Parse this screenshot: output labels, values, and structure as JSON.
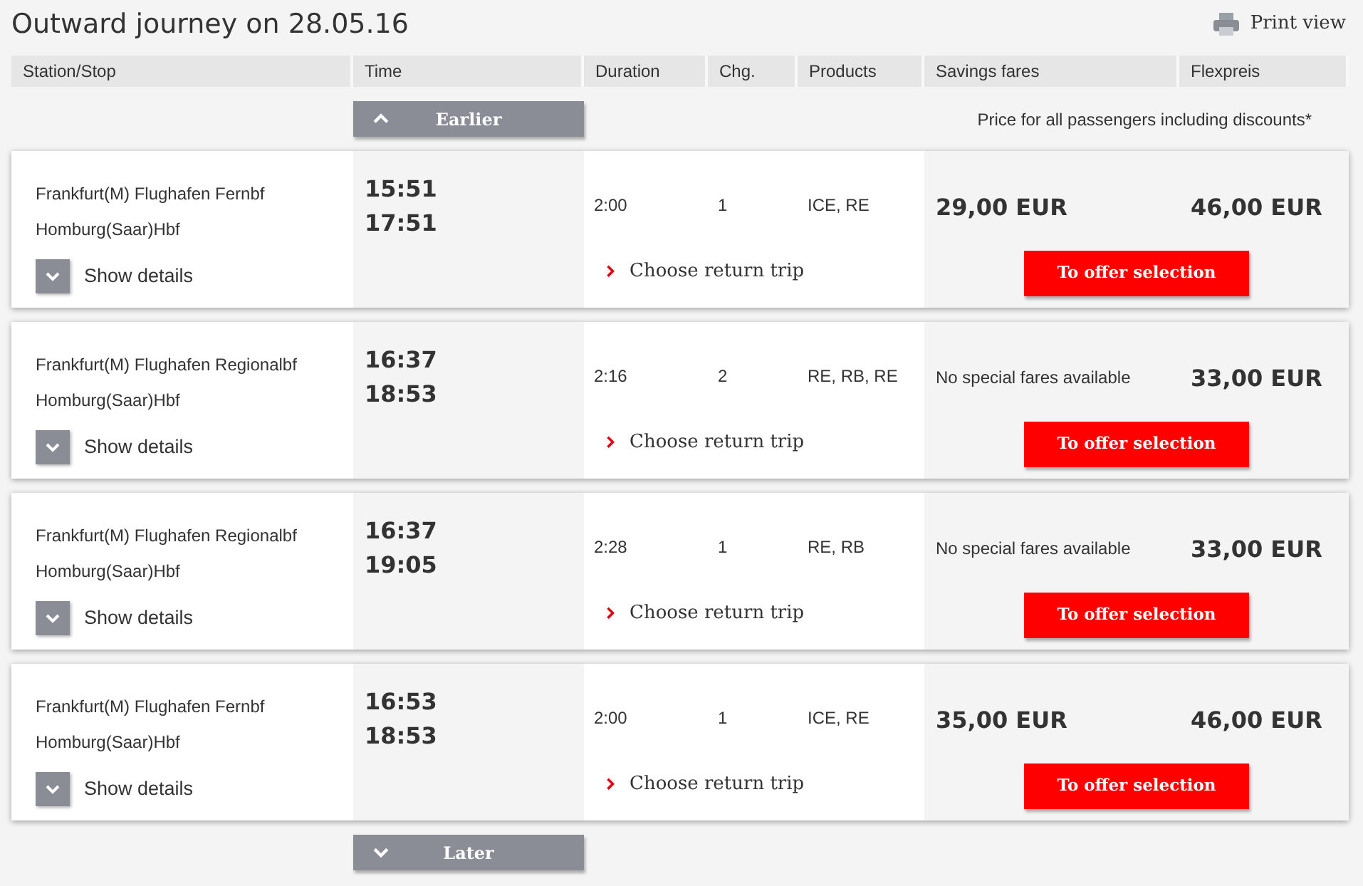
{
  "title": "Outward journey on 28.05.16",
  "print_label": "Print view",
  "columns": [
    "Station/Stop",
    "Time",
    "Duration",
    "Chg.",
    "Products",
    "Savings fares",
    "Flexpreis"
  ],
  "earlier_label": "Earlier",
  "price_note": "Price for all passengers including discounts*",
  "connections": [
    {
      "from": "Frankfurt(M) Flughafen Fernbf",
      "to": "Homburg(Saar)Hbf",
      "departure": "15:51",
      "arrival": "17:51",
      "duration": "2:00",
      "changes": "1",
      "products": "ICE, RE",
      "savings": {
        "kind": "price",
        "text": "29,00 EUR"
      },
      "flexpreis": "46,00 EUR",
      "details_label": "Show details",
      "return_label": "Choose return trip",
      "offer_label": "To offer selection"
    },
    {
      "from": "Frankfurt(M) Flughafen Regionalbf",
      "to": "Homburg(Saar)Hbf",
      "departure": "16:37",
      "arrival": "18:53",
      "duration": "2:16",
      "changes": "2",
      "products": "RE, RB, RE",
      "savings": {
        "kind": "note",
        "text": "No special fares available"
      },
      "flexpreis": "33,00 EUR",
      "details_label": "Show details",
      "return_label": "Choose return trip",
      "offer_label": "To offer selection"
    },
    {
      "from": "Frankfurt(M) Flughafen Regionalbf",
      "to": "Homburg(Saar)Hbf",
      "departure": "16:37",
      "arrival": "19:05",
      "duration": "2:28",
      "changes": "1",
      "products": "RE, RB",
      "savings": {
        "kind": "note",
        "text": "No special fares available"
      },
      "flexpreis": "33,00 EUR",
      "details_label": "Show details",
      "return_label": "Choose return trip",
      "offer_label": "To offer selection"
    },
    {
      "from": "Frankfurt(M) Flughafen Fernbf",
      "to": "Homburg(Saar)Hbf",
      "departure": "16:53",
      "arrival": "18:53",
      "duration": "2:00",
      "changes": "1",
      "products": "ICE, RE",
      "savings": {
        "kind": "price",
        "text": "35,00 EUR"
      },
      "flexpreis": "46,00 EUR",
      "details_label": "Show details",
      "return_label": "Choose return trip",
      "offer_label": "To offer selection"
    }
  ],
  "later_label": "Later"
}
